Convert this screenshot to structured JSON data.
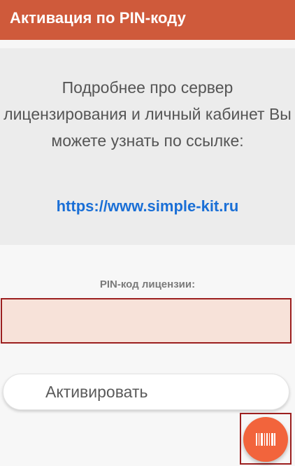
{
  "app_bar": {
    "title": "Активация по PIN-коду"
  },
  "info": {
    "text": "Подробнее про сервер лицензирования и личный кабинет Вы можете узнать по ссылке:",
    "link_text": "https://www.simple-kit.ru"
  },
  "pin": {
    "label": "PIN-код лицензии:",
    "value": ""
  },
  "actions": {
    "activate_label": "Активировать"
  },
  "fab": {
    "icon": "barcode-icon"
  },
  "colors": {
    "app_bar": "#cf5a3b",
    "link": "#1a6fd6",
    "pin_field_bg": "#f7e2d9",
    "error_border": "#9c1f1f",
    "fab": "#f2643c"
  }
}
